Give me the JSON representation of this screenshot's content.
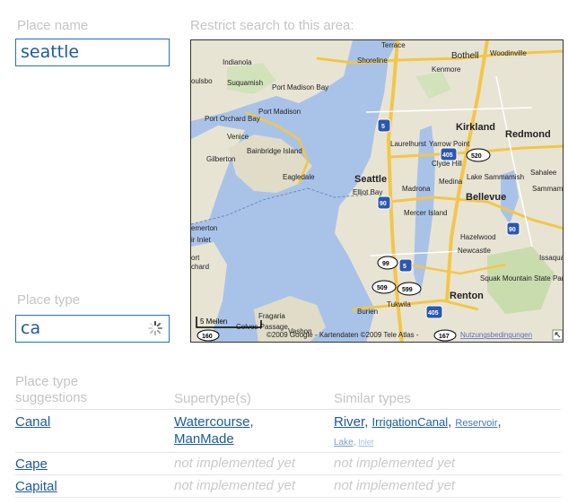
{
  "search": {
    "place_name_label": "Place name",
    "place_name_value": "seattle",
    "area_label": "Restrict search to this area:",
    "place_type_label": "Place type",
    "place_type_value": "ca"
  },
  "map": {
    "labels": {
      "terrace": "Terrace",
      "shoreline": "Shoreline",
      "bothell": "Bothell",
      "woodinville": "Woodinville",
      "kenmore": "Kenmore",
      "indianola": "Indianola",
      "poulsbo": "oulsbo",
      "suquamish": "Suquamish",
      "port_madison_bay": "Port Madison Bay",
      "port_madison": "Port Madison",
      "port_orchard_bay": "Port Orchard Bay",
      "venice": "Venice",
      "kirkland": "Kirkland",
      "redmond": "Redmond",
      "laurelhurst": "Laurelhurst",
      "yarrow_point": "Yarrow Point",
      "clyde_hill": "Clyde Hill",
      "gilberton": "Gilberton",
      "bainbridge_island": "Bainbridge Island",
      "eagledale": "Eagledale",
      "seattle": "Seattle",
      "elliot_bay": "Elliot Bay",
      "madrona": "Madrona",
      "medina": "Medina",
      "lake_sammamish": "Lake Sammamish",
      "sahalee": "Sahalee",
      "sammamish": "Sammam",
      "bellevue": "Bellevue",
      "emerton": "emerton",
      "inlet": "ir Inlet",
      "ort": "ort",
      "chard": "chard",
      "mercer_island": "Mercer Island",
      "hazelwood": "Hazelwood",
      "newcastle": "Newcastle",
      "issaqua": "Issaqua",
      "squak": "Squak Mountain State Park",
      "fragaria": "Fragaria",
      "renton": "Renton",
      "burien": "Burien",
      "tukwila": "Tukwila",
      "vashon": "Vashon",
      "colvos": "Colvos Passage"
    },
    "shields": [
      "5",
      "405",
      "520",
      "90",
      "90",
      "99",
      "5",
      "509",
      "599",
      "405",
      "167",
      "160"
    ],
    "scale": "5 Meilen",
    "copyright": "©2009 Google - Kartendaten ©2009 Tele Atlas -",
    "terms_link": "Nutzungsbedingungen"
  },
  "table": {
    "headers": {
      "suggestions": "Place type suggestions",
      "supertypes": "Supertype(s)",
      "similar": "Similar types"
    },
    "rows": [
      {
        "name": "Canal",
        "supertypes": [
          "Watercourse",
          "ManMade"
        ],
        "similar": [
          "River",
          "IrrigationCanal",
          "Reservoir",
          "Lake",
          "Inlet"
        ]
      },
      {
        "name": "Cape",
        "supertypes_text": "not implemented yet",
        "similar_text": "not implemented yet"
      },
      {
        "name": "Capital",
        "supertypes_text": "not implemented yet",
        "similar_text": "not implemented yet"
      }
    ]
  },
  "colors": {
    "link": "#1c5a9c",
    "muted": "#c4c4c4",
    "field_border": "#1f6fc7"
  }
}
